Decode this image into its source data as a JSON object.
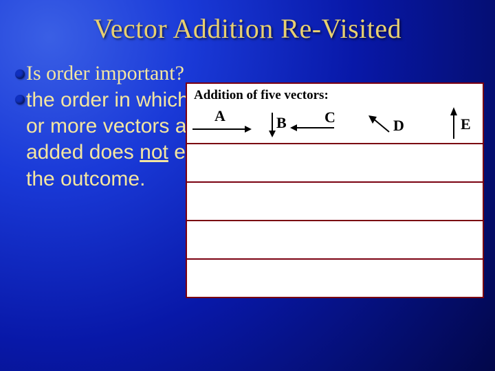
{
  "title": "Vector Addition Re-Visited",
  "bullet1": "Is order important?",
  "bullet2_pre": "the order in which two or more vectors are added does ",
  "bullet2_underline": "not",
  "bullet2_post": " effect the outcome.",
  "figure": {
    "caption": "Addition of five vectors:",
    "vectors": {
      "A": "A",
      "B": "B",
      "C": "C",
      "D": "D",
      "E": "E"
    }
  }
}
